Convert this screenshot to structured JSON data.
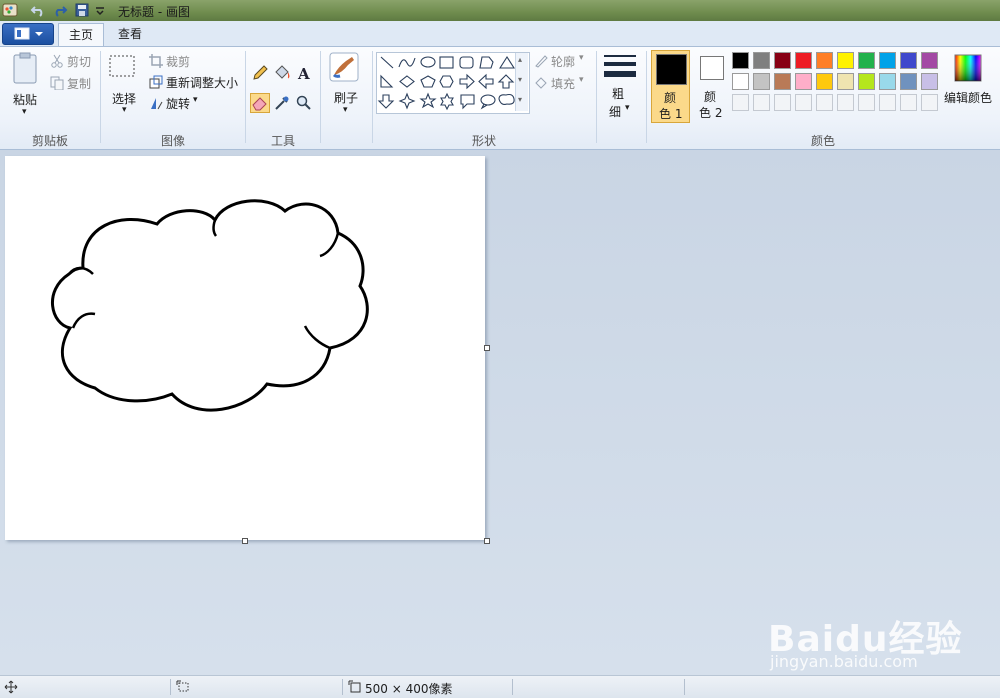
{
  "window": {
    "title": "无标题 - 画图"
  },
  "tabs": [
    {
      "label": "主页"
    },
    {
      "label": "查看"
    }
  ],
  "clipboard": {
    "paste": "粘贴",
    "cut": "剪切",
    "copy": "复制",
    "group": "剪贴板"
  },
  "image": {
    "select": "选择",
    "crop": "裁剪",
    "resize": "重新调整大小",
    "rotate": "旋转",
    "group": "图像"
  },
  "tools": {
    "group": "工具",
    "selected": "eraser-icon"
  },
  "brushes": {
    "label": "刷子"
  },
  "shapes": {
    "outline": "轮廓",
    "fill": "填充",
    "group": "形状"
  },
  "size": {
    "label_top": "粗",
    "label_bottom": "细"
  },
  "colors": {
    "color1_top": "颜",
    "color1_bottom": "色 1",
    "color2_top": "颜",
    "color2_bottom": "色 2",
    "edit": "编辑颜色",
    "group": "颜色",
    "color1_value": "#000000",
    "color2_value": "#ffffff",
    "row1": [
      "#000000",
      "#7f7f7f",
      "#880015",
      "#ed1c24",
      "#ff7f27",
      "#fff200",
      "#22b14c",
      "#00a2e8",
      "#3f48cc",
      "#a349a4"
    ],
    "row2": [
      "#ffffff",
      "#c3c3c3",
      "#b97a57",
      "#ffaec9",
      "#ffc90e",
      "#efe4b0",
      "#b5e61d",
      "#99d9ea",
      "#7092be",
      "#c8bfe7"
    ]
  },
  "status": {
    "size": "500 × 400像素"
  },
  "watermark": {
    "logo": "Baidu经验",
    "url": "jingyan.baidu.com"
  }
}
